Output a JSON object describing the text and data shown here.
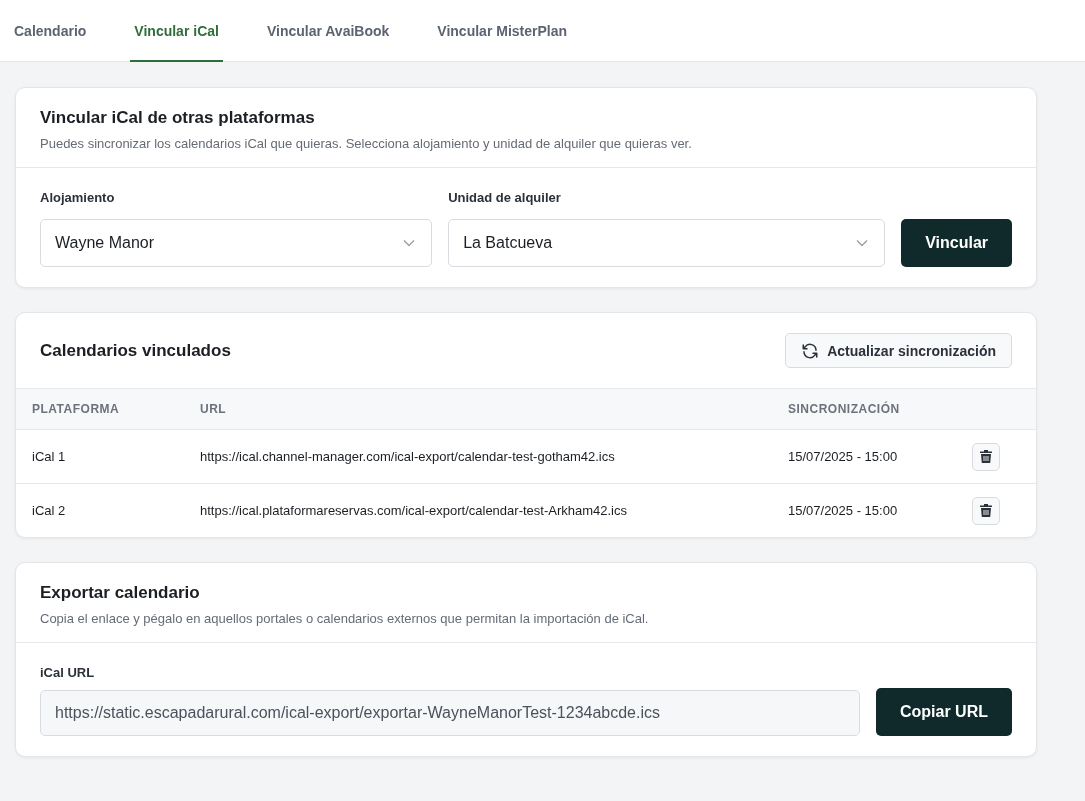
{
  "tabs": [
    {
      "label": "Calendario",
      "selected": false
    },
    {
      "label": "Vincular iCal",
      "selected": true
    },
    {
      "label": "Vincular AvaiBook",
      "selected": false
    },
    {
      "label": "Vincular MisterPlan",
      "selected": false
    }
  ],
  "link_card": {
    "title": "Vincular iCal de otras plataformas",
    "subtitle": "Puedes sincronizar los calendarios iCal que quieras. Selecciona alojamiento y unidad de alquiler que quieras ver.",
    "fields": [
      {
        "label": "Alojamiento",
        "value": "Wayne Manor"
      },
      {
        "label": "Unidad de alquiler",
        "value": "La Batcueva"
      }
    ],
    "button": "Vincular"
  },
  "linked_card": {
    "title": "Calendarios vinculados",
    "button": "Actualizar sincronización",
    "table": {
      "columns": [
        "PLATAFORMA",
        "URL",
        "SINCRONIZACIÓN"
      ],
      "rows": [
        {
          "platform": "iCal 1",
          "url": "https://ical.channel-manager.com/ical-export/calendar-test-gotham42.ics",
          "sync": "15/07/2025 - 15:00"
        },
        {
          "platform": "iCal 2",
          "url": "https://ical.plataformareservas.com/ical-export/calendar-test-Arkham42.ics",
          "sync": "15/07/2025 - 15:00"
        }
      ]
    }
  },
  "export_card": {
    "title": "Exportar calendario",
    "subtitle": "Copia el enlace y pégalo en aquellos portales o calendarios externos que permitan la importación de iCal.",
    "field_label": "iCal URL",
    "value": "https://static.escapadarural.com/ical-export/exportar-WayneManorTest-1234abcde.ics",
    "button": "Copiar URL"
  }
}
